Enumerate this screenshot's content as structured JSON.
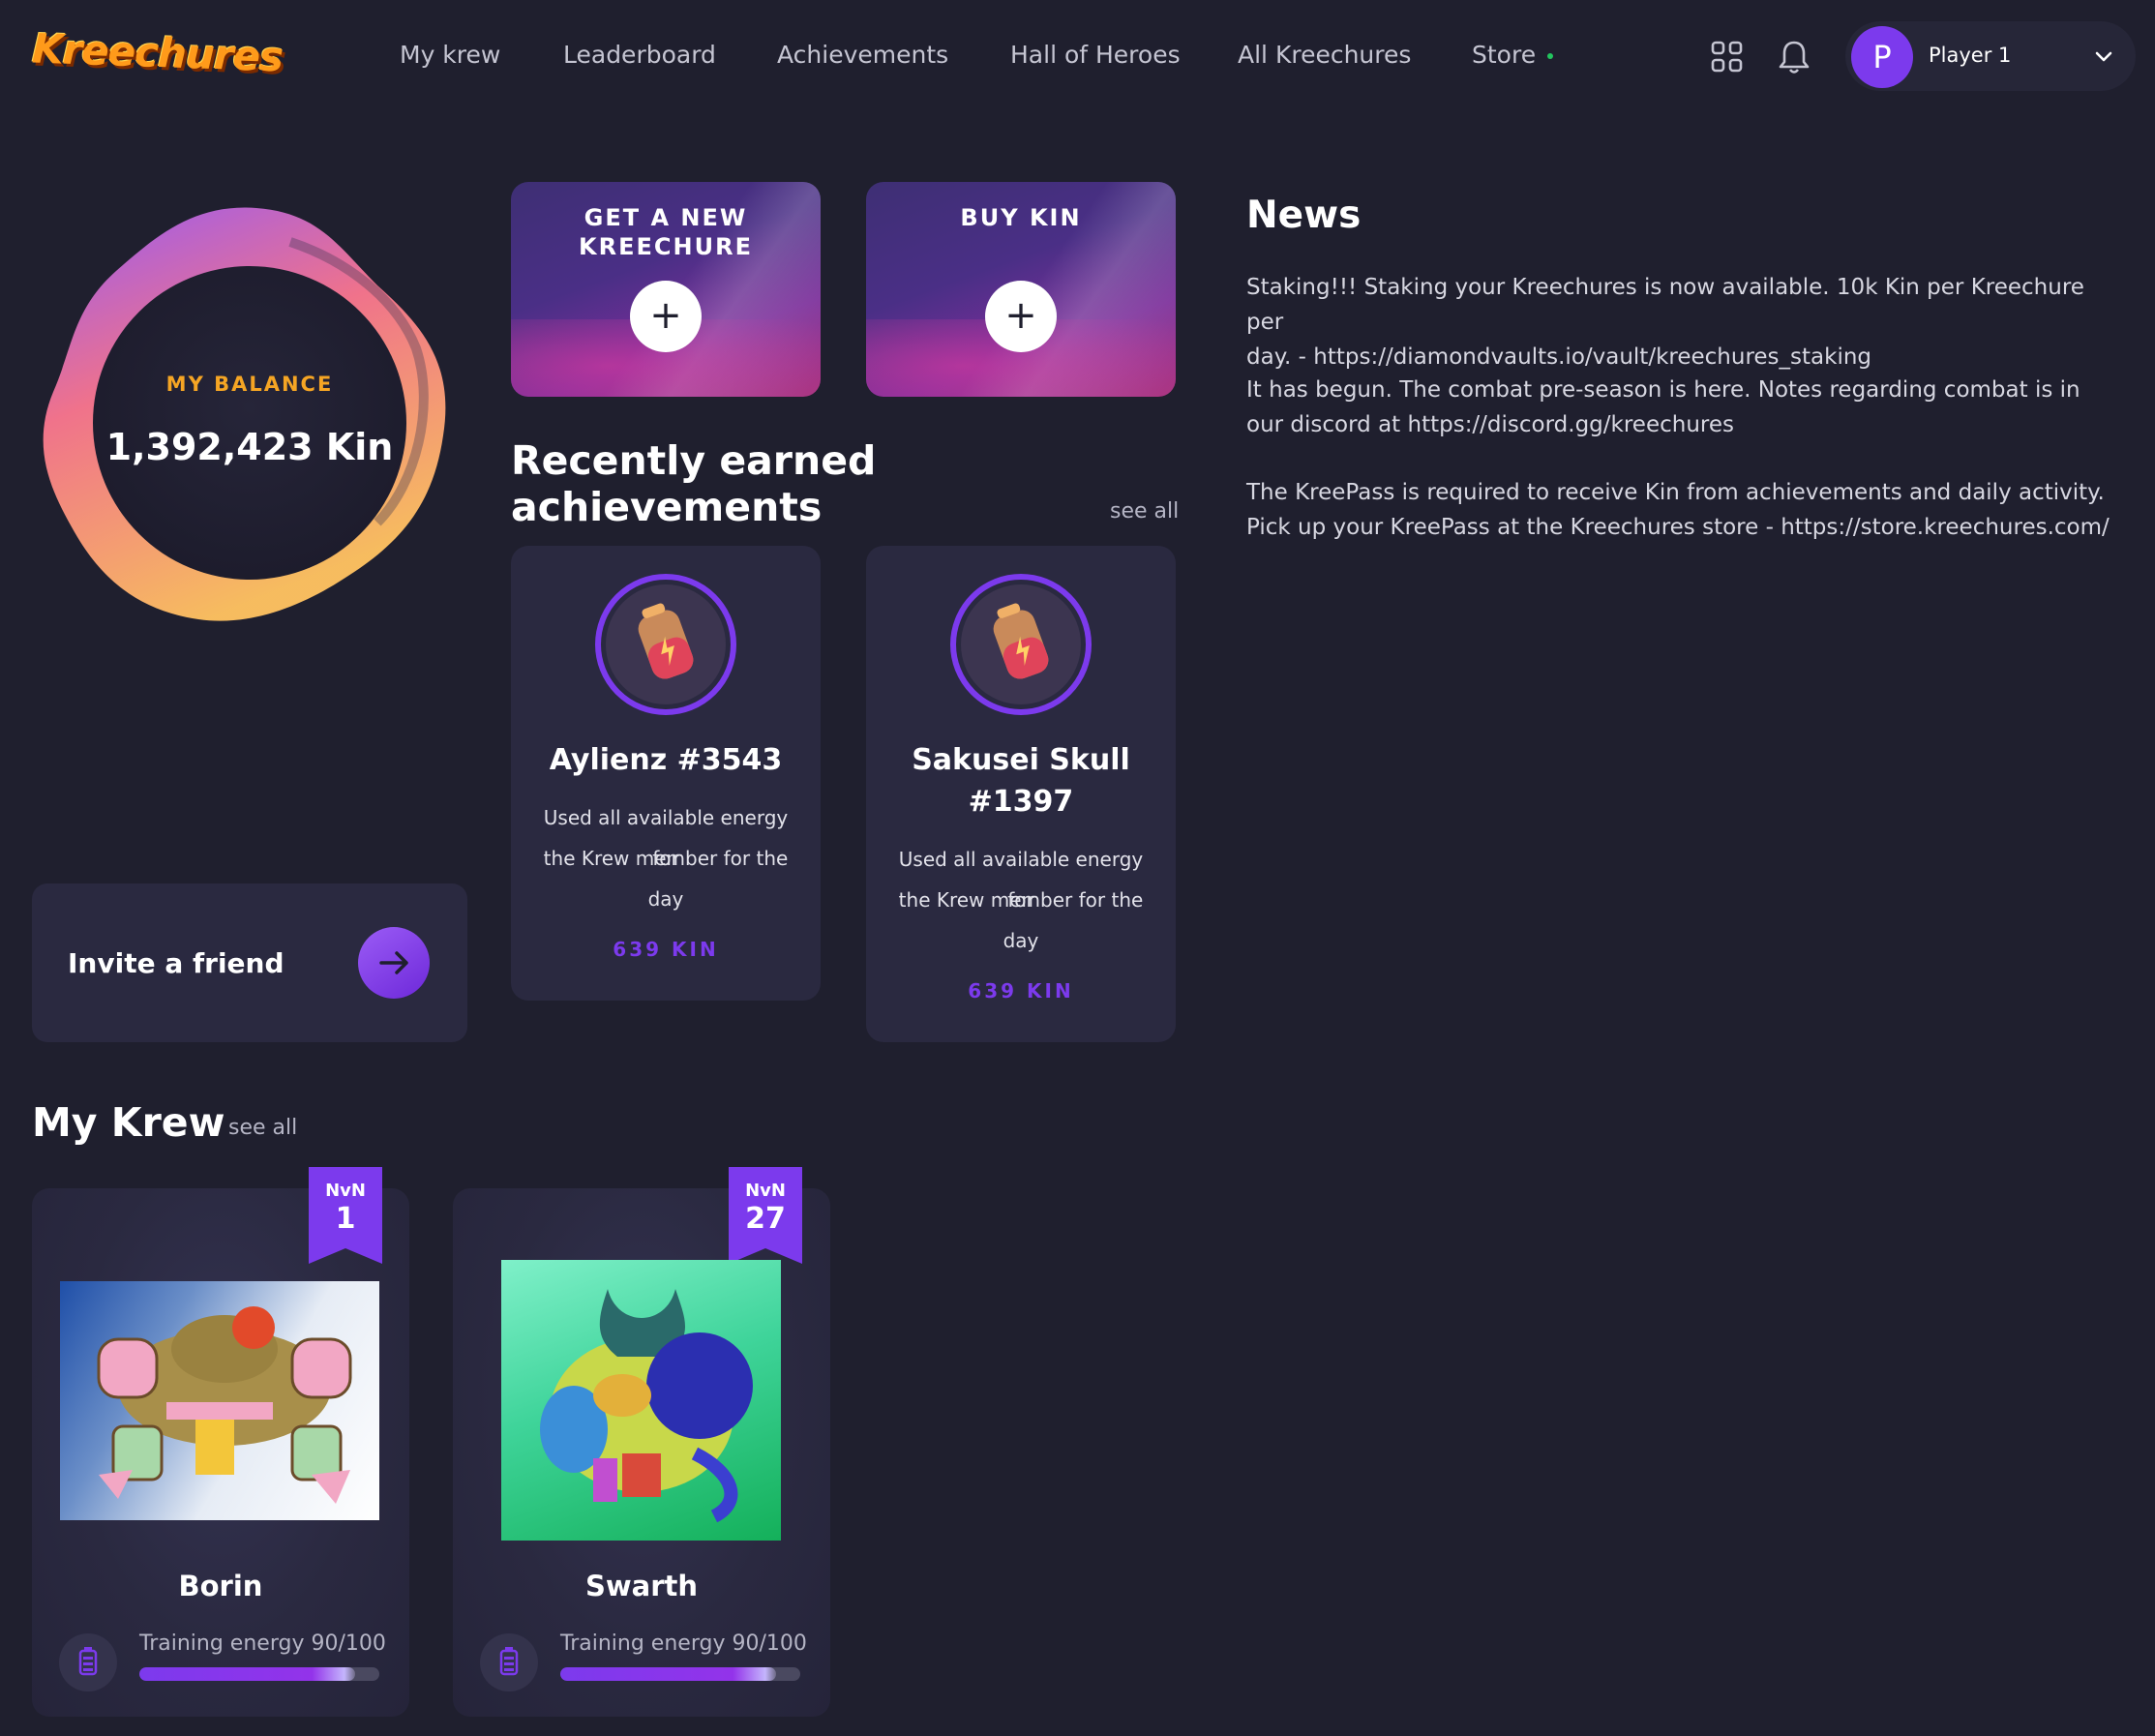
{
  "header": {
    "logo_text": "Kreechures",
    "nav": [
      {
        "label": "My krew"
      },
      {
        "label": "Leaderboard"
      },
      {
        "label": "Achievements"
      },
      {
        "label": "Hall of Heroes"
      },
      {
        "label": "All Kreechures"
      },
      {
        "label": "Store"
      }
    ],
    "icons": [
      "grid-icon",
      "bell-icon"
    ],
    "user": {
      "avatar_letter": "P",
      "name": "Player 1"
    }
  },
  "balance": {
    "label": "MY BALANCE",
    "value": "1,392,423 Kin"
  },
  "actions": [
    {
      "title_line1": "GET A NEW",
      "title_line2": "KREECHURE",
      "button": "+"
    },
    {
      "title_line1": "BUY KIN",
      "title_line2": "",
      "button": "+"
    }
  ],
  "achievements": {
    "title_line1": "Recently earned",
    "title_line2": "achievements",
    "see_all": "see all",
    "items": [
      {
        "name_line1": "Aylienz #3543",
        "name_line2": "",
        "desc_line1": "Used all available energy for",
        "desc_line2": "the Krew member for the",
        "desc_line3": "day",
        "reward": "639 KIN"
      },
      {
        "name_line1": "Sakusei Skull",
        "name_line2": "#1397",
        "desc_line1": "Used all available energy for",
        "desc_line2": "the Krew member for the",
        "desc_line3": "day",
        "reward": "639 KIN"
      }
    ]
  },
  "news": {
    "title": "News",
    "items": [
      {
        "line1": "Staking!!! Staking your Kreechures is now available. 10k Kin per Kreechure per",
        "line2": "day. - https://diamondvaults.io/vault/kreechures_staking"
      },
      {
        "line1": "It has begun. The combat pre-season is here. Notes regarding combat is in",
        "line2": "our discord at https://discord.gg/kreechures"
      },
      {
        "line1": "The KreePass is required to receive Kin from achievements and daily activity.",
        "line2": "Pick up your KreePass at the Kreechures store - https://store.kreechures.com/"
      }
    ]
  },
  "invite": {
    "label": "Invite a friend"
  },
  "krew": {
    "title": "My Krew",
    "see_all": "see all",
    "members": [
      {
        "name": "Borin",
        "ribbon_label": "NvN",
        "ribbon_number": "1",
        "energy_label": "Training energy",
        "energy_value": "90/100",
        "energy_fraction": 0.9
      },
      {
        "name": "Swarth",
        "ribbon_label": "NvN",
        "ribbon_number": "27",
        "energy_label": "Training energy",
        "energy_value": "90/100",
        "energy_fraction": 0.9
      }
    ]
  },
  "colors": {
    "background": "#1f1f2e",
    "card": "#2a2940",
    "accent_purple": "#7c3aed",
    "balance_label": "#f5a524",
    "store_dot": "#22c55e"
  }
}
